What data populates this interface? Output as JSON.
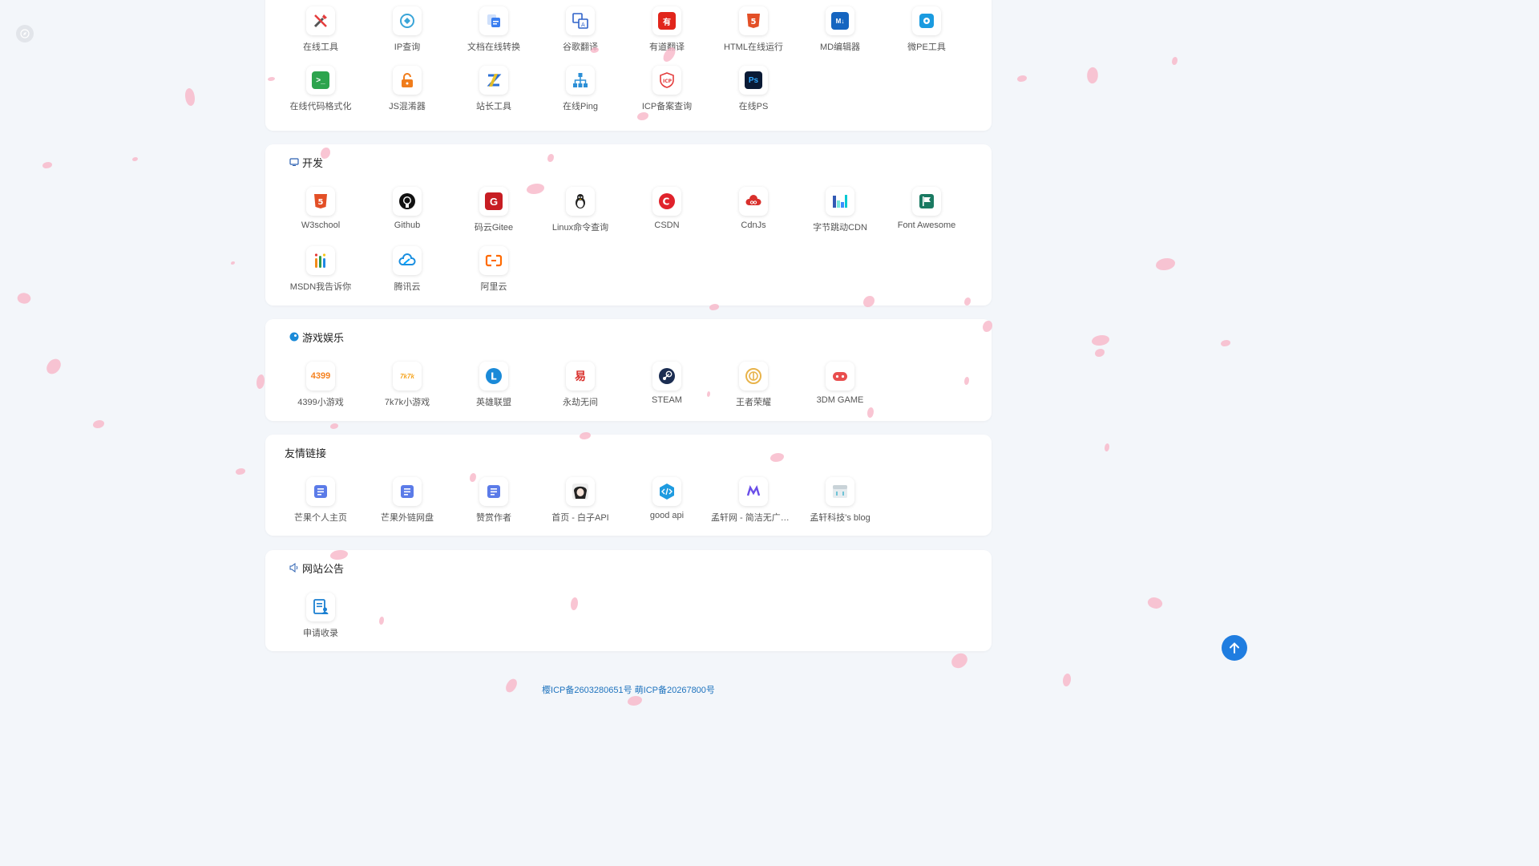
{
  "colors": {
    "background": "#f3f6fa",
    "card": "#ffffff",
    "accent": "#1f7de0",
    "petal": "#f7b6c8",
    "footer_link": "#1e73be"
  },
  "tools_section": {
    "items": [
      {
        "label": "在线工具",
        "icon": "tools-icon"
      },
      {
        "label": "IP查询",
        "icon": "ip-icon"
      },
      {
        "label": "文档在线转换",
        "icon": "doc-convert-icon"
      },
      {
        "label": "谷歌翻译",
        "icon": "translate-icon"
      },
      {
        "label": "有道翻译",
        "icon": "youdao-icon"
      },
      {
        "label": "HTML在线运行",
        "icon": "html5-icon"
      },
      {
        "label": "MD编辑器",
        "icon": "markdown-icon"
      },
      {
        "label": "微PE工具",
        "icon": "wepe-icon"
      },
      {
        "label": "在线代码格式化",
        "icon": "terminal-icon"
      },
      {
        "label": "JS混淆器",
        "icon": "lock-icon"
      },
      {
        "label": "站长工具",
        "icon": "zhanzhang-icon"
      },
      {
        "label": "在线Ping",
        "icon": "network-icon"
      },
      {
        "label": "ICP备案查询",
        "icon": "icp-icon"
      },
      {
        "label": "在线PS",
        "icon": "photoshop-icon"
      }
    ]
  },
  "dev_section": {
    "title": "开发",
    "items": [
      {
        "label": "W3school",
        "icon": "w3school-icon"
      },
      {
        "label": "Github",
        "icon": "github-icon"
      },
      {
        "label": "码云Gitee",
        "icon": "gitee-icon"
      },
      {
        "label": "Linux命令查询",
        "icon": "linux-icon"
      },
      {
        "label": "CSDN",
        "icon": "csdn-icon"
      },
      {
        "label": "CdnJs",
        "icon": "cdnjs-icon"
      },
      {
        "label": "字节跳动CDN",
        "icon": "bytedance-icon"
      },
      {
        "label": "Font Awesome",
        "icon": "font-awesome-icon"
      },
      {
        "label": "MSDN我告诉你",
        "icon": "msdn-icon"
      },
      {
        "label": "腾讯云",
        "icon": "tencent-cloud-icon"
      },
      {
        "label": "阿里云",
        "icon": "aliyun-icon"
      }
    ]
  },
  "games_section": {
    "title": "游戏娱乐",
    "items": [
      {
        "label": "4399小游戏",
        "icon": "game-4399-icon"
      },
      {
        "label": "7k7k小游戏",
        "icon": "game-7k7k-icon"
      },
      {
        "label": "英雄联盟",
        "icon": "lol-icon"
      },
      {
        "label": "永劫无间",
        "icon": "naraka-icon"
      },
      {
        "label": "STEAM",
        "icon": "steam-icon"
      },
      {
        "label": "王者荣耀",
        "icon": "honor-of-kings-icon"
      },
      {
        "label": "3DM GAME",
        "icon": "3dm-icon"
      }
    ]
  },
  "links_section": {
    "title": "友情链接",
    "items": [
      {
        "label": "芒果个人主页",
        "icon": "page-icon"
      },
      {
        "label": "芒果外链网盘",
        "icon": "page-icon"
      },
      {
        "label": "赞赏作者",
        "icon": "page-icon"
      },
      {
        "label": "首页 - 白子API",
        "icon": "avatar-icon"
      },
      {
        "label": "good api",
        "icon": "code-icon"
      },
      {
        "label": "孟轩网 - 简洁无广告…",
        "icon": "mengxuan-icon"
      },
      {
        "label": "孟轩科技's blog",
        "icon": "blog-icon"
      }
    ]
  },
  "notice_section": {
    "title": "网站公告",
    "items": [
      {
        "label": "申请收录",
        "icon": "apply-icon"
      }
    ]
  },
  "footer": {
    "icp1": "樱ICP备2603280651号",
    "icp2": "萌ICP备20267800号"
  }
}
